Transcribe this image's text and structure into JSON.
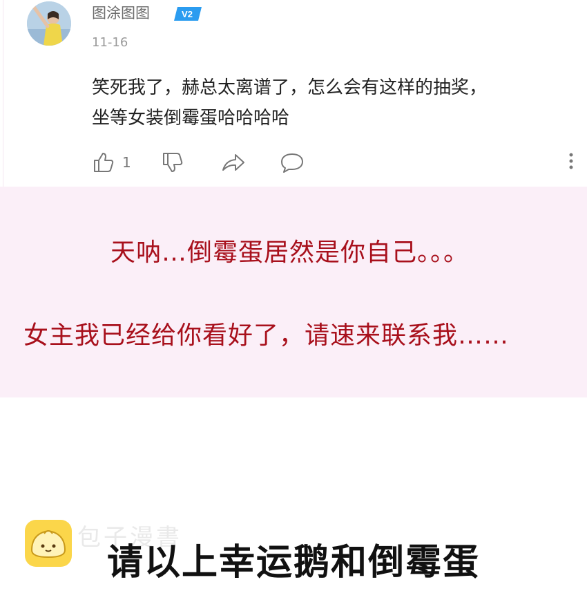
{
  "comment": {
    "username": "图涂图图",
    "level_badge": "V2",
    "date": "11-16",
    "body_lines": [
      "笑死我了，赫总太离谱了，怎么会有这样的抽奖，",
      "坐等女装倒霉蛋哈哈哈哈"
    ],
    "actions": {
      "like_icon": "thumbs-up-icon",
      "like_count": "1",
      "dislike_icon": "thumbs-down-icon",
      "share_icon": "share-icon",
      "reply_icon": "comment-icon",
      "more_icon": "vertical-dots-icon"
    }
  },
  "overlay": {
    "line1": "天呐…倒霉蛋居然是你自己。。。",
    "line2": "女主我已经给你看好了，请速来联系我……"
  },
  "watermark": {
    "logo_icon": "bun-logo-icon",
    "text": "包子漫書"
  },
  "caption": "请以上幸运鹅和倒霉蛋",
  "colors": {
    "overlay_text": "#a8101c",
    "overlay_bg": "#fbeff8",
    "badge": "#2b9cf0"
  }
}
